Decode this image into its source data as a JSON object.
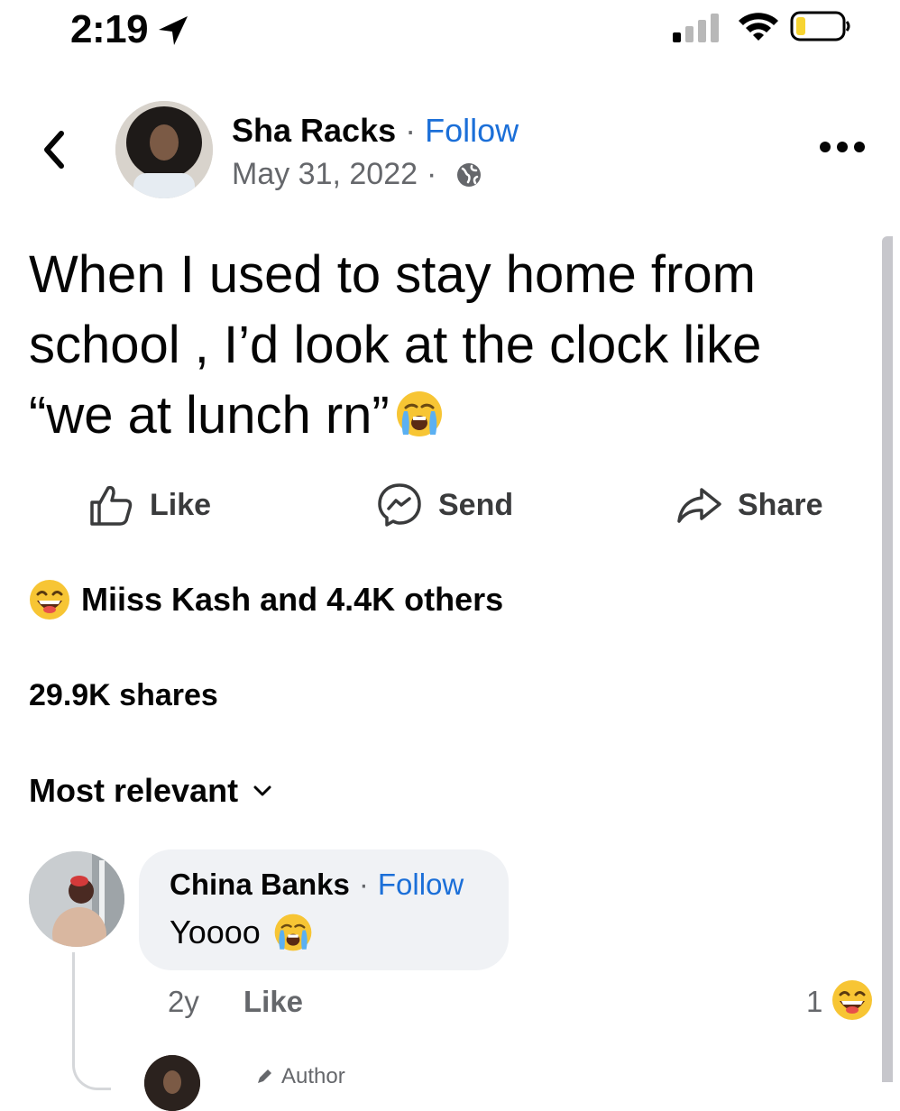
{
  "status_bar": {
    "time": "2:19",
    "icons": [
      "location-arrow-icon",
      "signal-icon",
      "wifi-icon",
      "battery-icon"
    ]
  },
  "post": {
    "author": "Sha Racks",
    "separator": "·",
    "follow_label": "Follow",
    "date": "May 31, 2022",
    "meta_separator": "·",
    "privacy_icon": "globe-icon",
    "text": "When I used to stay home from school , I’d look at the clock like “we at lunch rn”",
    "text_emoji": "crying-face-emoji"
  },
  "actions": {
    "like_label": "Like",
    "send_label": "Send",
    "share_label": "Share"
  },
  "reactions": {
    "emoji": "laughing-face-emoji",
    "summary": "Miiss Kash and 4.4K others"
  },
  "shares_text": "29.9K shares",
  "sort": {
    "label": "Most relevant"
  },
  "comment": {
    "author": "China Banks",
    "separator": "·",
    "follow_label": "Follow",
    "text": "Yoooo",
    "text_emoji": "crying-face-emoji",
    "age": "2y",
    "like_label": "Like",
    "reaction_count": "1",
    "reaction_emoji": "laughing-face-emoji"
  },
  "reply": {
    "badge_label": "Author"
  },
  "colors": {
    "link_blue": "#1b6fd8",
    "secondary_text": "#65676b",
    "bubble_bg": "#f0f2f5",
    "battery_yellow": "#f7d432"
  }
}
